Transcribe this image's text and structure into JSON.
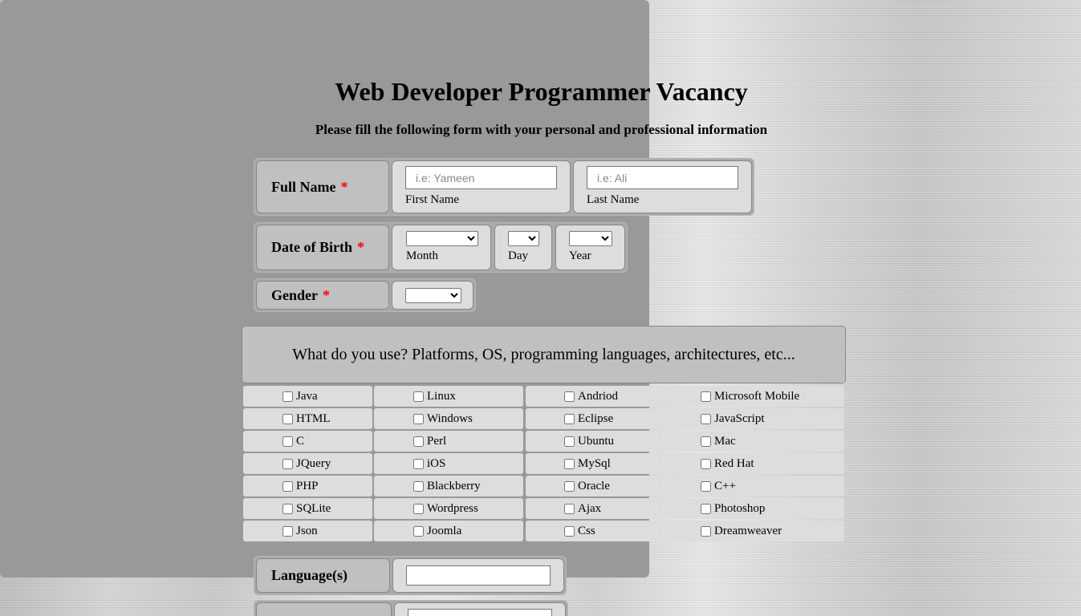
{
  "title": "Web Developer Programmer Vacancy",
  "subtitle": "Please fill the following form with your personal and professional information",
  "required_mark": "*",
  "full_name": {
    "label": "Full Name",
    "first_placeholder": "i.e: Yameen",
    "first_caption": "First Name",
    "last_placeholder": "i.e: Ali",
    "last_caption": "Last Name"
  },
  "dob": {
    "label": "Date of Birth",
    "month": "Month",
    "day": "Day",
    "year": "Year"
  },
  "gender": {
    "label": "Gender"
  },
  "question": "What do you use? Platforms, OS, programming languages, architectures, etc...",
  "options": [
    [
      "Java",
      "Linux",
      "Andriod",
      "Microsoft Mobile"
    ],
    [
      "HTML",
      "Windows",
      "Eclipse",
      "JavaScript"
    ],
    [
      "C",
      "Perl",
      "Ubuntu",
      "Mac"
    ],
    [
      "JQuery",
      "iOS",
      "MySql",
      "Red Hat"
    ],
    [
      "PHP",
      "Blackberry",
      "Oracle",
      "C++"
    ],
    [
      "SQLite",
      "Wordpress",
      "Ajax",
      "Photoshop"
    ],
    [
      "Json",
      "Joomla",
      "Css",
      "Dreamweaver"
    ]
  ],
  "languages": {
    "label": "Language(s)",
    "value": ""
  }
}
